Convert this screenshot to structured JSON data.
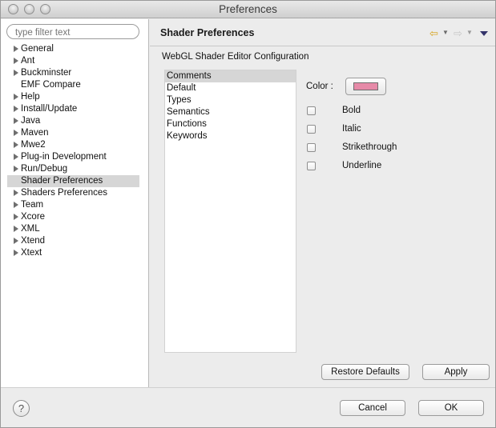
{
  "window": {
    "title": "Preferences"
  },
  "filter": {
    "placeholder": "type filter text"
  },
  "tree": {
    "items": [
      {
        "label": "General",
        "expandable": true
      },
      {
        "label": "Ant",
        "expandable": true
      },
      {
        "label": "Buckminster",
        "expandable": true
      },
      {
        "label": "EMF Compare",
        "expandable": false
      },
      {
        "label": "Help",
        "expandable": true
      },
      {
        "label": "Install/Update",
        "expandable": true
      },
      {
        "label": "Java",
        "expandable": true
      },
      {
        "label": "Maven",
        "expandable": true
      },
      {
        "label": "Mwe2",
        "expandable": true
      },
      {
        "label": "Plug-in Development",
        "expandable": true
      },
      {
        "label": "Run/Debug",
        "expandable": true
      },
      {
        "label": "Shader Preferences",
        "expandable": false,
        "selected": true
      },
      {
        "label": "Shaders Preferences",
        "expandable": true
      },
      {
        "label": "Team",
        "expandable": true
      },
      {
        "label": "Xcore",
        "expandable": true
      },
      {
        "label": "XML",
        "expandable": true
      },
      {
        "label": "Xtend",
        "expandable": true
      },
      {
        "label": "Xtext",
        "expandable": true
      }
    ]
  },
  "page": {
    "title": "Shader Preferences",
    "config_label": "WebGL Shader Editor Configuration",
    "nav_icons": [
      "back-arrow-icon",
      "forward-arrow-icon",
      "view-menu-icon"
    ]
  },
  "syntax_list": {
    "items": [
      "Comments",
      "Default",
      "Types",
      "Semantics",
      "Functions",
      "Keywords"
    ],
    "selected_index": 0
  },
  "color": {
    "label": "Color :",
    "value": "#e68aa8"
  },
  "options": [
    {
      "label": "Bold",
      "checked": false
    },
    {
      "label": "Italic",
      "checked": false
    },
    {
      "label": "Strikethrough",
      "checked": false
    },
    {
      "label": "Underline",
      "checked": false
    }
  ],
  "buttons": {
    "restore_defaults": "Restore Defaults",
    "apply": "Apply",
    "cancel": "Cancel",
    "ok": "OK",
    "help": "?"
  }
}
